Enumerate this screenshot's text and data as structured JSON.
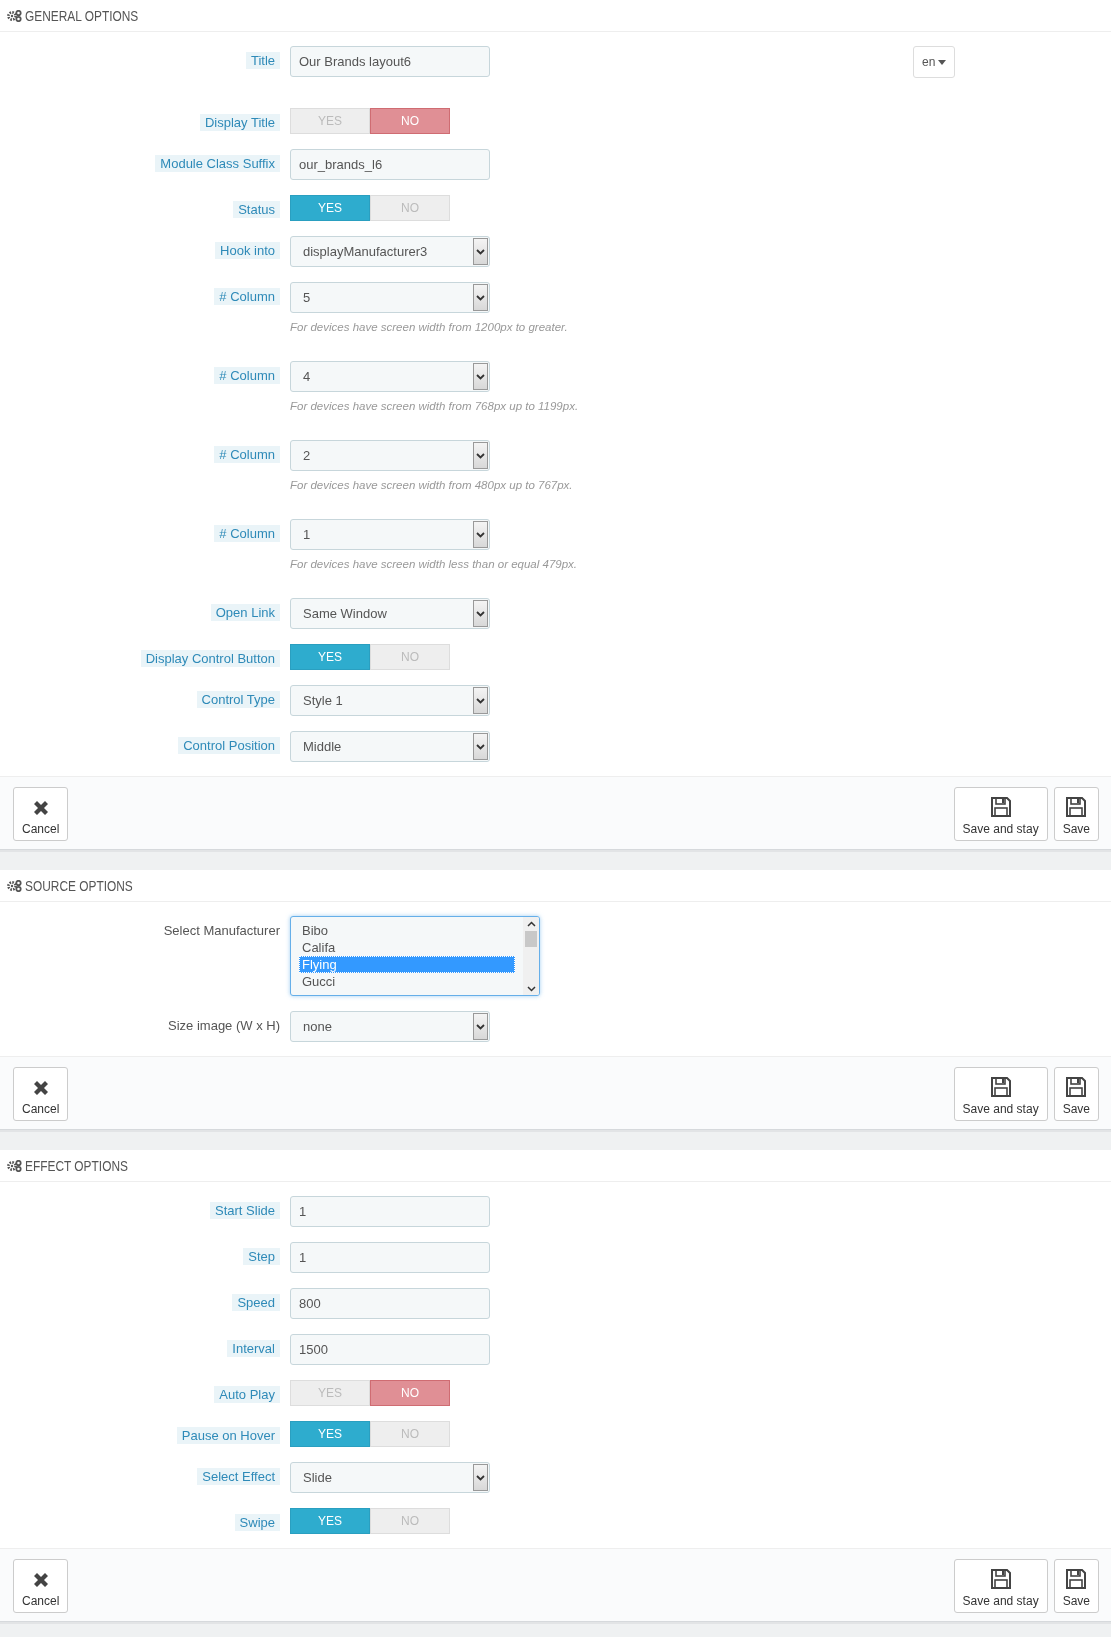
{
  "sections": [
    {
      "title": "GENERAL OPTIONS",
      "fields": [
        {
          "kind": "text",
          "label": "Title",
          "label_highlighted": true,
          "value": "Our Brands layout6",
          "language": "en"
        },
        {
          "kind": "toggle",
          "label": "Display Title",
          "label_highlighted": true,
          "options": [
            {
              "label": "YES",
              "selected": false
            },
            {
              "label": "NO",
              "selected": true
            }
          ]
        },
        {
          "kind": "text",
          "label": "Module Class Suffix",
          "label_highlighted": true,
          "value": "our_brands_l6"
        },
        {
          "kind": "toggle",
          "label": "Status",
          "label_highlighted": true,
          "options": [
            {
              "label": "YES",
              "selected": true
            },
            {
              "label": "NO",
              "selected": false
            }
          ]
        },
        {
          "kind": "select",
          "label": "Hook into",
          "label_highlighted": true,
          "value": "displayManufacturer3"
        },
        {
          "kind": "select",
          "label": "# Column",
          "label_highlighted": true,
          "value": "5",
          "hint": "For devices have screen width from 1200px to greater."
        },
        {
          "kind": "select",
          "label": "# Column",
          "label_highlighted": true,
          "value": "4",
          "hint": "For devices have screen width from 768px up to 1199px."
        },
        {
          "kind": "select",
          "label": "# Column",
          "label_highlighted": true,
          "value": "2",
          "hint": "For devices have screen width from 480px up to 767px."
        },
        {
          "kind": "select",
          "label": "# Column",
          "label_highlighted": true,
          "value": "1",
          "hint": "For devices have screen width less than or equal 479px."
        },
        {
          "kind": "select",
          "label": "Open Link",
          "label_highlighted": true,
          "value": "Same Window"
        },
        {
          "kind": "toggle",
          "label": "Display Control Button",
          "label_highlighted": true,
          "options": [
            {
              "label": "YES",
              "selected": true
            },
            {
              "label": "NO",
              "selected": false
            }
          ]
        },
        {
          "kind": "select",
          "label": "Control Type",
          "label_highlighted": true,
          "value": "Style 1"
        },
        {
          "kind": "select",
          "label": "Control Position",
          "label_highlighted": true,
          "value": "Middle"
        }
      ],
      "buttons": [
        {
          "kind": "cancel",
          "label": "Cancel"
        },
        {
          "kind": "save",
          "label": "Save and stay"
        },
        {
          "kind": "save",
          "label": "Save"
        }
      ]
    },
    {
      "title": "SOURCE OPTIONS",
      "fields": [
        {
          "kind": "listbox",
          "label": "Select Manufacturer",
          "label_highlighted": false,
          "items": [
            {
              "label": "Bibo",
              "selected": false
            },
            {
              "label": "Califa",
              "selected": false
            },
            {
              "label": "Flying",
              "selected": true
            },
            {
              "label": "Gucci",
              "selected": false
            }
          ]
        },
        {
          "kind": "select",
          "label": "Size image (W x H)",
          "label_highlighted": false,
          "value": "none"
        }
      ],
      "buttons": [
        {
          "kind": "cancel",
          "label": "Cancel"
        },
        {
          "kind": "save",
          "label": "Save and stay"
        },
        {
          "kind": "save",
          "label": "Save"
        }
      ]
    },
    {
      "title": "EFFECT OPTIONS",
      "fields": [
        {
          "kind": "text",
          "label": "Start Slide",
          "label_highlighted": true,
          "value": "1"
        },
        {
          "kind": "text",
          "label": "Step",
          "label_highlighted": true,
          "value": "1"
        },
        {
          "kind": "text",
          "label": "Speed",
          "label_highlighted": true,
          "value": "800"
        },
        {
          "kind": "text",
          "label": "Interval",
          "label_highlighted": true,
          "value": "1500"
        },
        {
          "kind": "toggle",
          "label": "Auto Play",
          "label_highlighted": true,
          "options": [
            {
              "label": "YES",
              "selected": false
            },
            {
              "label": "NO",
              "selected": true
            }
          ]
        },
        {
          "kind": "toggle",
          "label": "Pause on Hover",
          "label_highlighted": true,
          "options": [
            {
              "label": "YES",
              "selected": true
            },
            {
              "label": "NO",
              "selected": false
            }
          ]
        },
        {
          "kind": "select",
          "label": "Select Effect",
          "label_highlighted": true,
          "value": "Slide"
        },
        {
          "kind": "toggle",
          "label": "Swipe",
          "label_highlighted": true,
          "options": [
            {
              "label": "YES",
              "selected": true
            },
            {
              "label": "NO",
              "selected": false
            }
          ]
        }
      ],
      "buttons": [
        {
          "kind": "cancel",
          "label": "Cancel"
        },
        {
          "kind": "save",
          "label": "Save and stay"
        },
        {
          "kind": "save",
          "label": "Save"
        }
      ]
    }
  ]
}
